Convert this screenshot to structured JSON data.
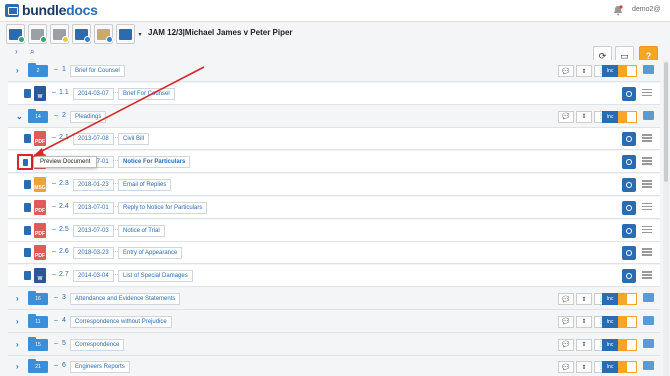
{
  "app": {
    "logo_part1": "bundle",
    "logo_part2": "docs",
    "user": "demo2@"
  },
  "case_title": "JAM 12/3|Michael James v Peter Piper",
  "tooltip": "Preview Document",
  "inc_label": "Inc",
  "rows": [
    {
      "kind": "section",
      "folder": "2",
      "num": "1",
      "title": "Brief for Counsel"
    },
    {
      "kind": "doc",
      "file": "word",
      "file_label": "W",
      "num": "1.1",
      "date": "2014-03-07",
      "title": "Brief For Counsel"
    },
    {
      "kind": "section",
      "folder": "14",
      "num": "2",
      "title": "Pleadings",
      "expanded": true
    },
    {
      "kind": "doc",
      "file": "pdf",
      "file_label": "PDF",
      "num": "2.1",
      "date": "2013-07-08",
      "title": "Civil Bill"
    },
    {
      "kind": "doc",
      "file": "pdf",
      "file_label": "PDF",
      "num": "2.2",
      "date": "2013-07-01",
      "title": "Notice For Particulars",
      "bold": true
    },
    {
      "kind": "doc",
      "file": "msg",
      "file_label": "MSG",
      "num": "2.3",
      "date": "2018-01-23",
      "title": "Email of Replies"
    },
    {
      "kind": "doc",
      "file": "pdf",
      "file_label": "PDF",
      "num": "2.4",
      "date": "2013-07-01",
      "title": "Reply to Notice for Particulars"
    },
    {
      "kind": "doc",
      "file": "pdf",
      "file_label": "PDF",
      "num": "2.5",
      "date": "2013-07-03",
      "title": "Notice of Trial"
    },
    {
      "kind": "doc",
      "file": "pdf",
      "file_label": "PDF",
      "num": "2.6",
      "date": "2018-03-23",
      "title": "Entry of Appearance"
    },
    {
      "kind": "doc",
      "file": "word",
      "file_label": "W",
      "num": "2.7",
      "date": "2014-03-04",
      "title": "List of Special Damages"
    },
    {
      "kind": "section",
      "folder": "16",
      "num": "3",
      "title": "Attendance and Evidence Statements"
    },
    {
      "kind": "section",
      "folder": "11",
      "num": "4",
      "title": "Correspondence without Prejudice"
    },
    {
      "kind": "section",
      "folder": "15",
      "num": "5",
      "title": "Correspondence"
    },
    {
      "kind": "section",
      "folder": "21",
      "num": "6",
      "title": "Engineers Reports"
    }
  ]
}
